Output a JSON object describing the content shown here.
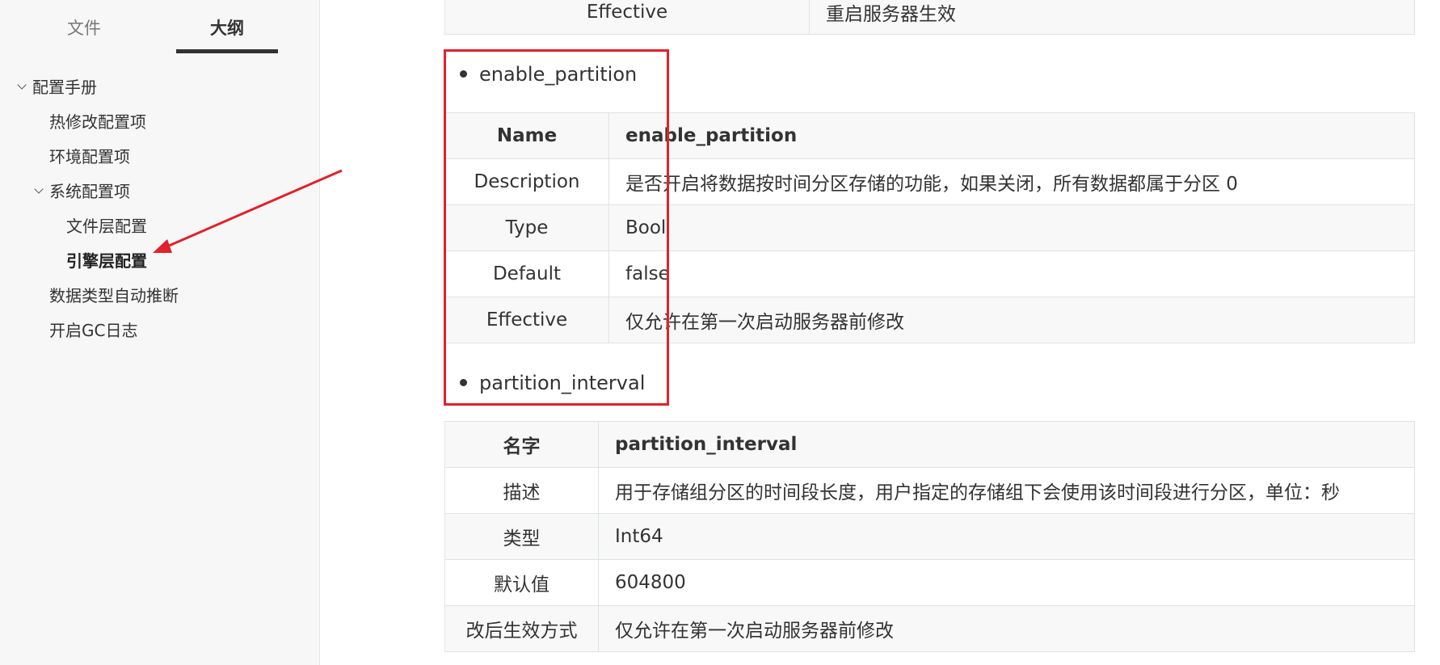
{
  "sidebar": {
    "tabs": [
      "文件",
      "大纲"
    ],
    "active_tab": "大纲",
    "outline": [
      "配置手册",
      "热修改配置项",
      "环境配置项",
      "系统配置项",
      "文件层配置",
      "引擎层配置",
      "数据类型自动推断",
      "开启GC日志"
    ],
    "active_item": "引擎层配置"
  },
  "annotation": {
    "color": "#e0222a"
  },
  "main": {
    "prev_table_row": {
      "key": "Effective",
      "value": "重启服务器生效"
    },
    "section1": {
      "bullet": "enable_partition",
      "header": {
        "key": "Name",
        "value": "enable_partition"
      },
      "rows": [
        {
          "key": "Description",
          "value": "是否开启将数据按时间分区存储的功能，如果关闭，所有数据都属于分区 0"
        },
        {
          "key": "Type",
          "value": "Bool"
        },
        {
          "key": "Default",
          "value": "false"
        },
        {
          "key": "Effective",
          "value": "仅允许在第一次启动服务器前修改"
        }
      ]
    },
    "section2": {
      "bullet": "partition_interval",
      "header": {
        "key": "名字",
        "value": "partition_interval"
      },
      "rows": [
        {
          "key": "描述",
          "value": "用于存储组分区的时间段长度，用户指定的存储组下会使用该时间段进行分区，单位：秒"
        },
        {
          "key": "类型",
          "value": "Int64"
        },
        {
          "key": "默认值",
          "value": "604800"
        },
        {
          "key": "改后生效方式",
          "value": "仅允许在第一次启动服务器前修改"
        }
      ]
    }
  }
}
